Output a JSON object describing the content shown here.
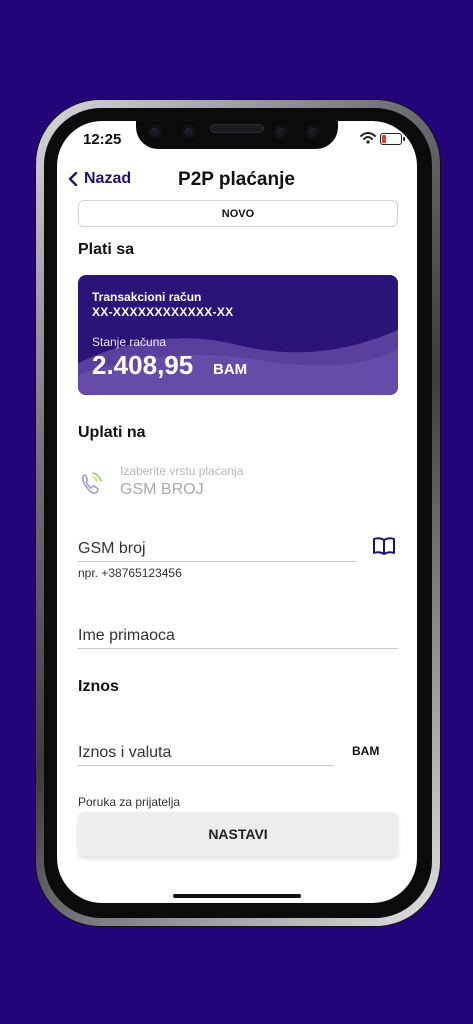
{
  "status_bar": {
    "time": "12:25"
  },
  "nav": {
    "back_label": "Nazad",
    "title": "P2P plaćanje"
  },
  "novo_button": "NOVO",
  "pay_from": {
    "heading": "Plati sa",
    "card": {
      "account_type": "Transakcioni račun",
      "account_number": "XX-XXXXXXXXXXXX-XX",
      "balance_label": "Stanje računa",
      "balance": "2.408,95",
      "currency": "BAM",
      "color": "#2a1478"
    }
  },
  "pay_to": {
    "heading": "Uplati na",
    "payment_type_label": "Izaberite vrstu plaćanja",
    "payment_type_value": "GSM BROJ",
    "gsm_placeholder": "GSM broj",
    "gsm_hint": "npr. +38765123456",
    "recipient_placeholder": "Ime primaoca"
  },
  "amount": {
    "heading": "Iznos",
    "placeholder": "Iznos i valuta",
    "currency": "BAM",
    "message_label": "Poruka za prijatelja"
  },
  "continue_button": "NASTAVI",
  "colors": {
    "background": "#230479",
    "accent": "#23126a"
  }
}
